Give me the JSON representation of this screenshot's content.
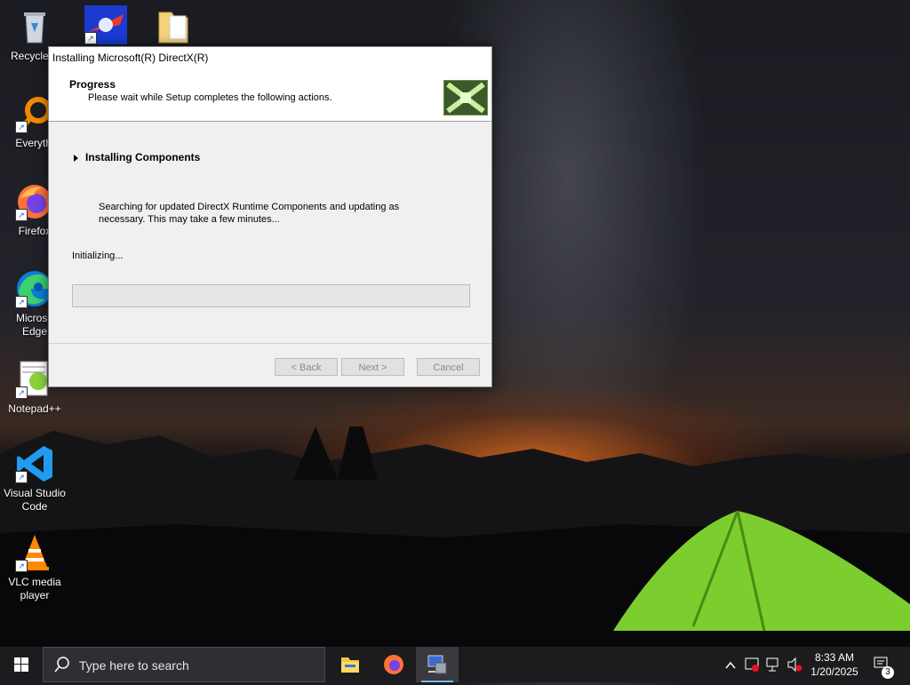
{
  "desktop": {
    "icons": [
      {
        "label": "Recycle B",
        "icon": "recycle-bin-icon"
      },
      {
        "label": "",
        "icon": "app-icon"
      },
      {
        "label": "",
        "icon": "folder-icon"
      },
      {
        "label": "Everythi",
        "icon": "everything-search-icon"
      },
      {
        "label": "Firefox",
        "icon": "firefox-icon"
      },
      {
        "label": "Microso Edge",
        "icon": "edge-icon"
      },
      {
        "label": "Notepad++",
        "icon": "notepad-plus-plus-icon"
      },
      {
        "label": "Visual Studio Code",
        "icon": "vscode-icon"
      },
      {
        "label": "VLC media player",
        "icon": "vlc-icon"
      }
    ]
  },
  "dialog": {
    "title": "Installing Microsoft(R) DirectX(R)",
    "header_title": "Progress",
    "header_subtitle": "Please wait while Setup completes the following actions.",
    "section_title": "Installing Components",
    "description": "Searching for updated DirectX Runtime Components and updating as necessary. This may take a few minutes...",
    "status": "Initializing...",
    "progress": 0,
    "buttons": {
      "back": "< Back",
      "next": "Next >",
      "cancel": "Cancel"
    }
  },
  "taskbar": {
    "search_placeholder": "Type here to search",
    "apps": [
      "file-explorer-icon",
      "firefox-icon",
      "setup-icon"
    ],
    "clock_time": "8:33 AM",
    "clock_date": "1/20/2025",
    "notification_count": "3"
  },
  "colors": {
    "taskbar": "#1c1c1e",
    "accent": "#76b9ed",
    "tent": "#7ccd2e"
  }
}
